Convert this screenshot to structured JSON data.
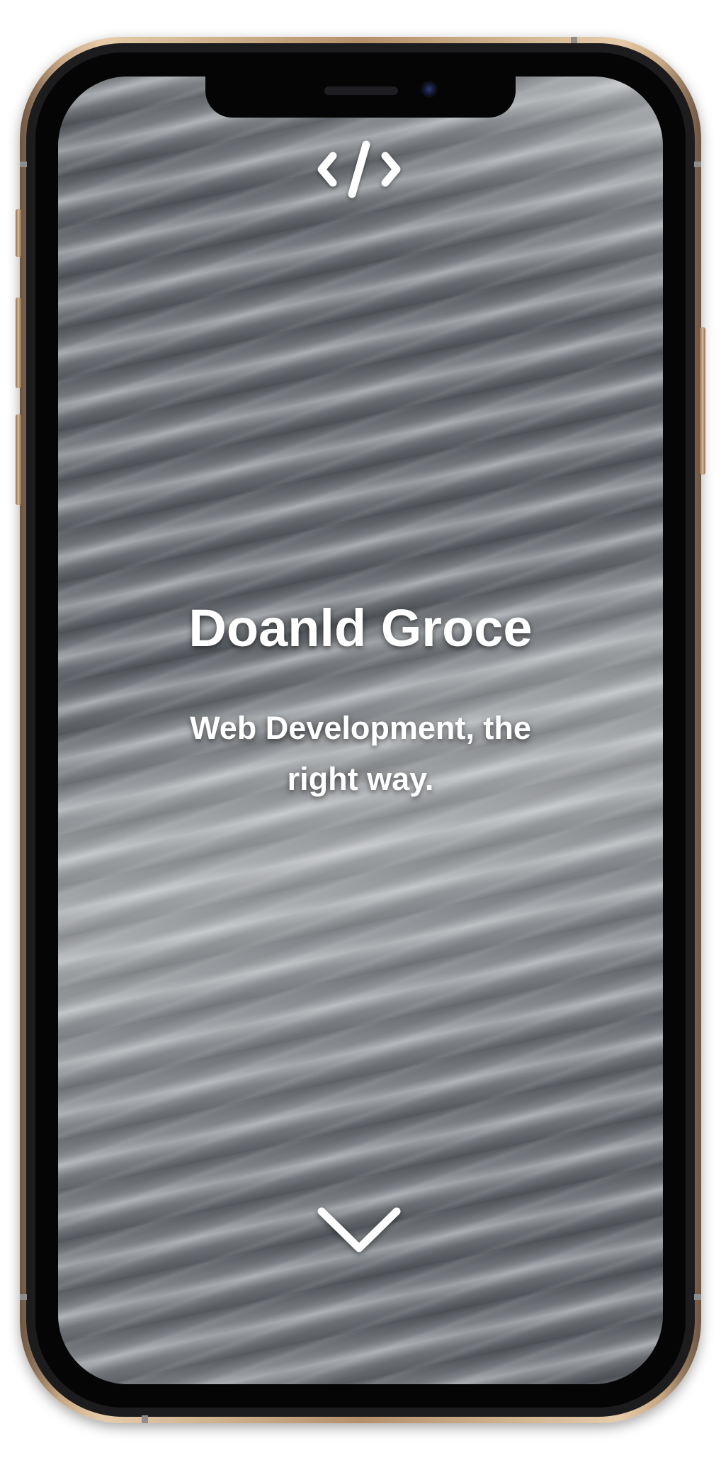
{
  "device": {
    "model": "iPhone",
    "frame_color": "#b48f6a",
    "screen_background": "#62666b"
  },
  "header": {
    "logo_icon": "code-brackets-icon"
  },
  "hero": {
    "title": "Doanld Groce",
    "subtitle": "Web Development, the right way."
  },
  "footer": {
    "scroll_icon": "chevron-down-icon"
  }
}
